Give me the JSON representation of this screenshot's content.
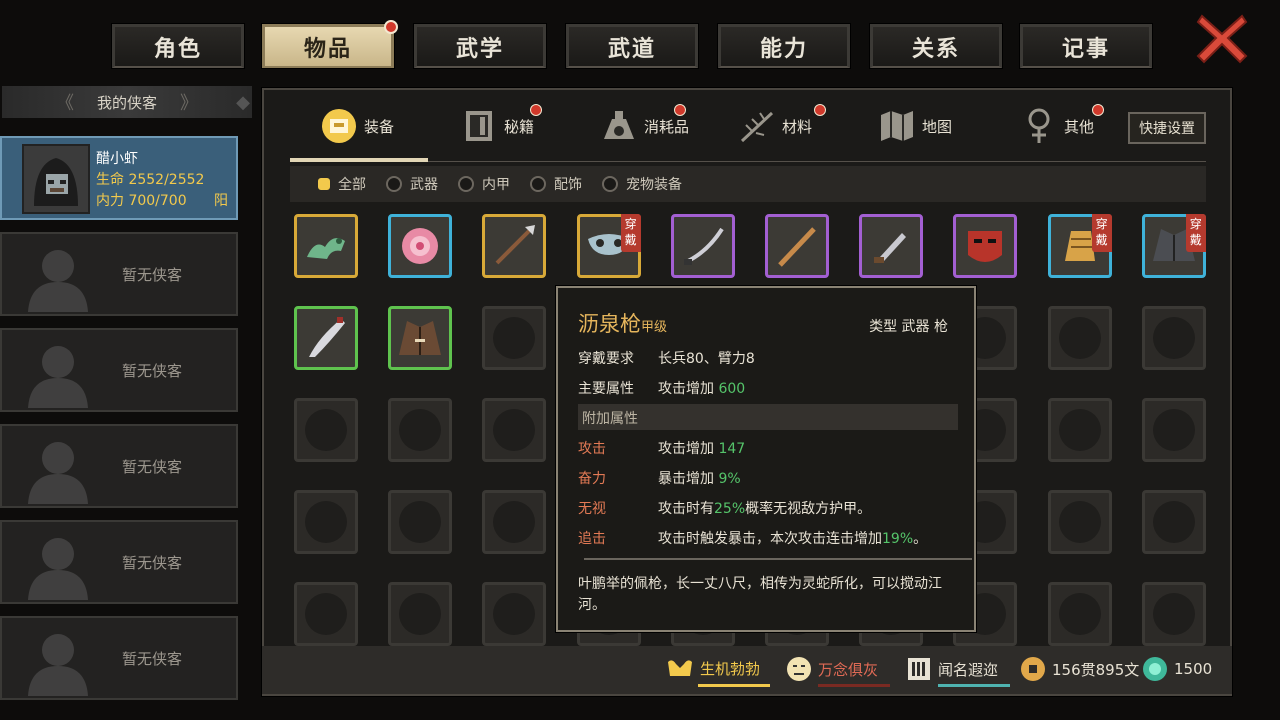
{
  "tabs": [
    {
      "label": "角色",
      "active": false,
      "badge": false
    },
    {
      "label": "物品",
      "active": true,
      "badge": true
    },
    {
      "label": "武学",
      "active": false,
      "badge": false
    },
    {
      "label": "武道",
      "active": false,
      "badge": false
    },
    {
      "label": "能力",
      "active": false,
      "badge": false
    },
    {
      "label": "关系",
      "active": false,
      "badge": false
    },
    {
      "label": "记事",
      "active": false,
      "badge": false
    }
  ],
  "roster": {
    "title": "我的侠客",
    "hero": {
      "name": "醋小虾",
      "hp": "生命 2552/2552",
      "mp": "内力 700/700",
      "yang": "阳"
    },
    "empty_label": "暂无侠客"
  },
  "categories": [
    {
      "label": "装备",
      "icon": "armor-icon",
      "badge": false,
      "active": true
    },
    {
      "label": "秘籍",
      "icon": "book-icon",
      "badge": true
    },
    {
      "label": "消耗品",
      "icon": "potion-icon",
      "badge": true
    },
    {
      "label": "材料",
      "icon": "herb-icon",
      "badge": true
    },
    {
      "label": "地图",
      "icon": "map-icon",
      "badge": false
    },
    {
      "label": "其他",
      "icon": "misc-icon",
      "badge": true
    }
  ],
  "quick_settings": "快捷设置",
  "filters": [
    {
      "label": "全部",
      "selected": true
    },
    {
      "label": "武器",
      "selected": false
    },
    {
      "label": "内甲",
      "selected": false
    },
    {
      "label": "配饰",
      "selected": false
    },
    {
      "label": "宠物装备",
      "selected": false
    }
  ],
  "worn_label": "穿戴",
  "items": [
    {
      "icon": "jade-dragon-icon",
      "rarity": "gold",
      "worn": false
    },
    {
      "icon": "peony-flower-icon",
      "rarity": "blue",
      "worn": false
    },
    {
      "icon": "spear-icon",
      "rarity": "gold",
      "worn": false
    },
    {
      "icon": "mask-icon",
      "rarity": "gold",
      "worn": true
    },
    {
      "icon": "saber-icon",
      "rarity": "purple",
      "worn": false
    },
    {
      "icon": "staff-icon",
      "rarity": "purple",
      "worn": false
    },
    {
      "icon": "dagger-icon",
      "rarity": "purple",
      "worn": false
    },
    {
      "icon": "demon-mask-icon",
      "rarity": "purple",
      "worn": false
    },
    {
      "icon": "gauntlet-icon",
      "rarity": "blue",
      "worn": true
    },
    {
      "icon": "robe-icon",
      "rarity": "blue",
      "worn": true
    },
    {
      "icon": "broadsword-icon",
      "rarity": "green",
      "worn": false
    },
    {
      "icon": "jacket-icon",
      "rarity": "green",
      "worn": false
    }
  ],
  "tooltip": {
    "name": "沥泉枪",
    "grade": "甲级",
    "type": "类型  武器 枪",
    "req_key": "穿戴要求",
    "req_val": "长兵80、臂力8",
    "main_key": "主要属性",
    "main_val": "攻击增加 ",
    "main_num": "600",
    "extra_title": "附加属性",
    "extras": [
      {
        "key": "攻击",
        "pre": "攻击增加 ",
        "num": "147",
        "post": ""
      },
      {
        "key": "奋力",
        "pre": "暴击增加 ",
        "num": "9%",
        "post": ""
      },
      {
        "key": "无视",
        "pre": "攻击时有",
        "num": "25%",
        "post": "概率无视敌方护甲。"
      },
      {
        "key": "追击",
        "pre": "攻击时触发暴击，本次攻击连击增加",
        "num": "19%",
        "post": "。"
      }
    ],
    "desc": "叶鹏举的佩枪，长一丈八尺，相传为灵蛇所化，可以搅动江河。"
  },
  "status": {
    "vitality": "生机勃勃",
    "mood": "万念俱灰",
    "fame": "闻名遐迩",
    "money": "156贯895文",
    "gems": "1500"
  }
}
